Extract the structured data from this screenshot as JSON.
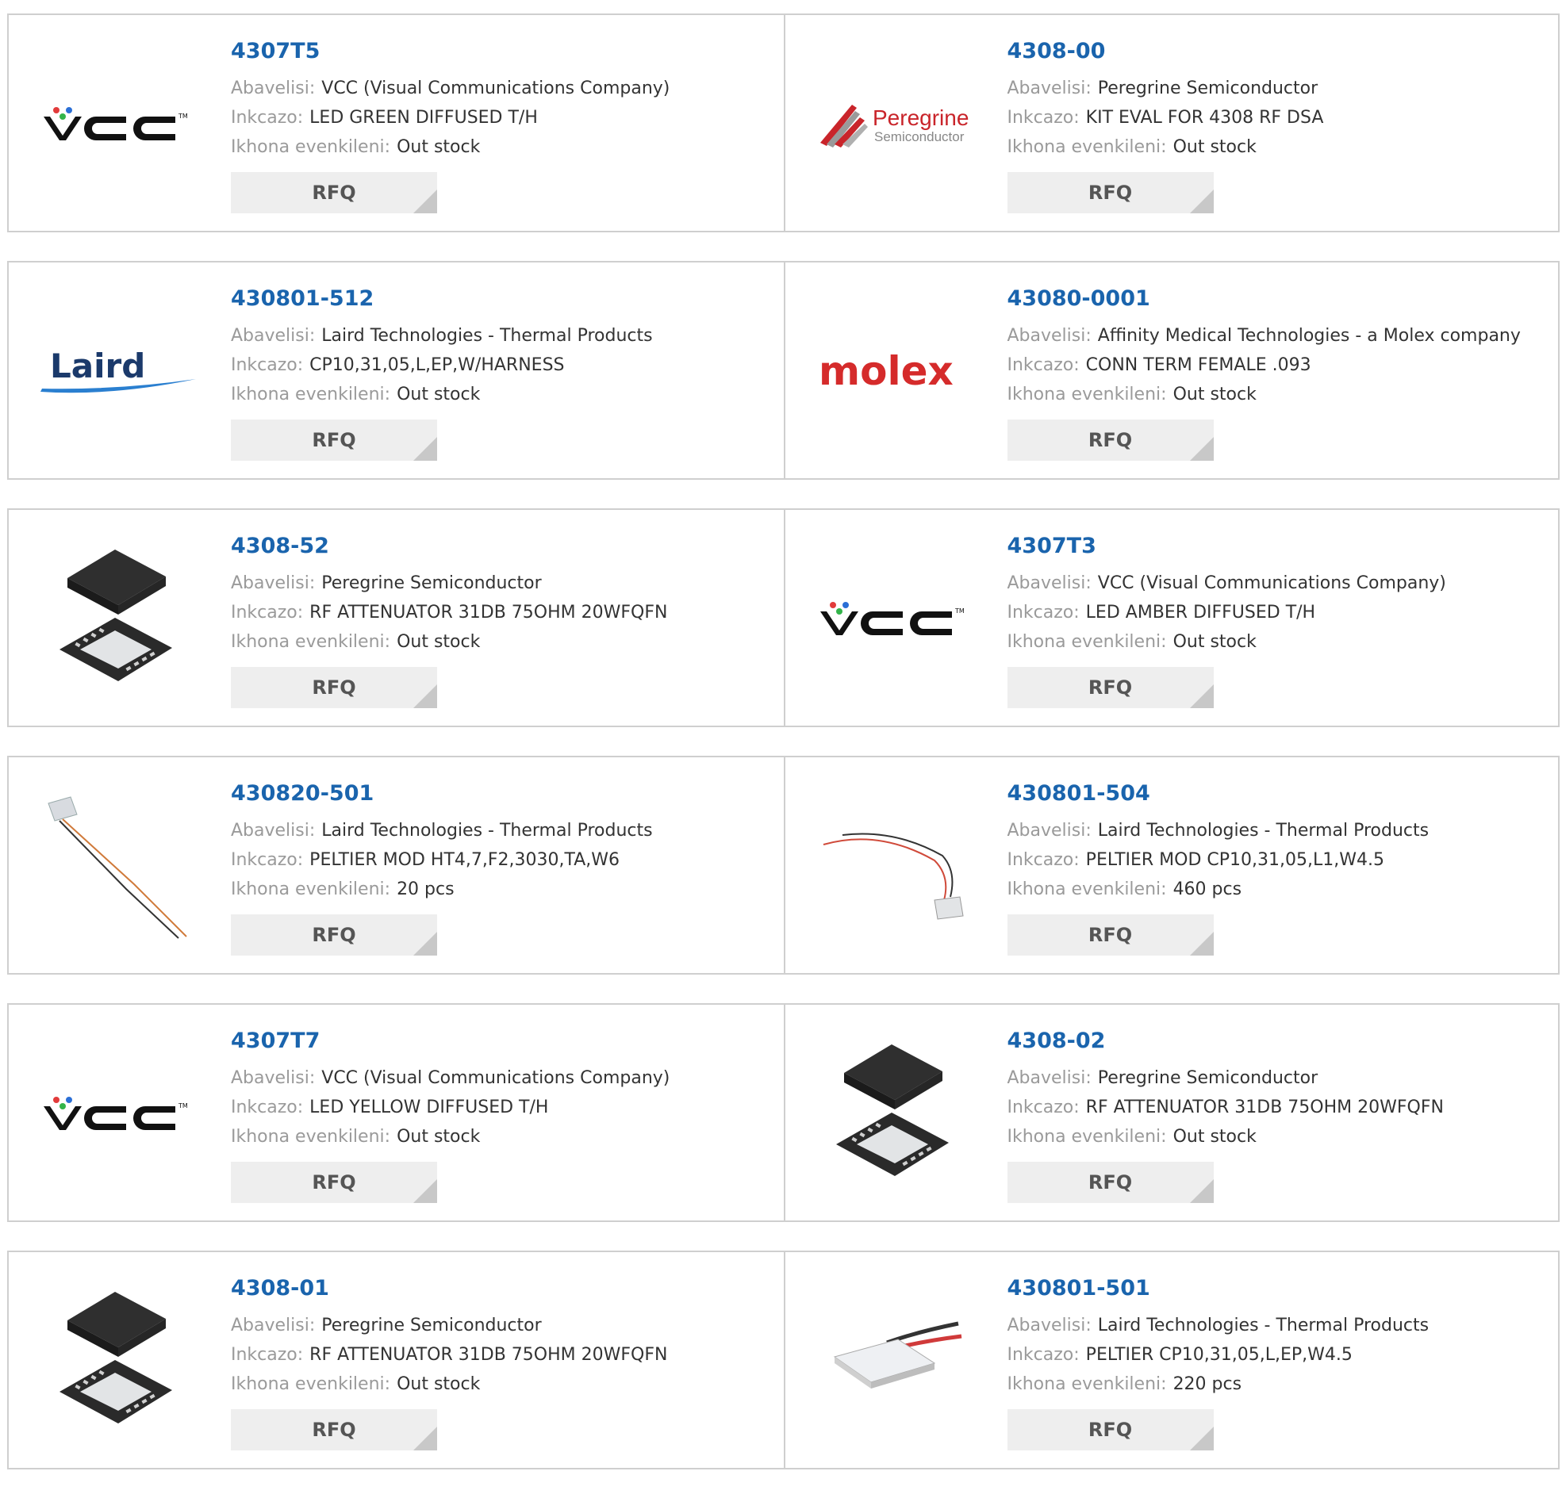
{
  "labels": {
    "supplier": "Abavelisi:",
    "description": "Inkcazo:",
    "stock": "Ikhona evenkileni:",
    "rfq": "RFQ"
  },
  "colors": {
    "part_link": "#1a64ad",
    "label": "#9a9a9a",
    "value": "#333333",
    "border": "#cfcfcf",
    "button_bg": "#eeeeee"
  },
  "products": [
    {
      "part": "4307T5",
      "supplier": "VCC (Visual Communications Company)",
      "description": "LED GREEN DIFFUSED T/H",
      "stock": "Out stock",
      "image": "vcc-logo"
    },
    {
      "part": "4308-00",
      "supplier": "Peregrine Semiconductor",
      "description": "KIT EVAL FOR 4308 RF DSA",
      "stock": "Out stock",
      "image": "peregrine-logo"
    },
    {
      "part": "430801-512",
      "supplier": "Laird Technologies - Thermal Products",
      "description": "CP10,31,05,L,EP,W/HARNESS",
      "stock": "Out stock",
      "image": "laird-logo"
    },
    {
      "part": "43080-0001",
      "supplier": "Affinity Medical Technologies - a Molex company",
      "description": "CONN TERM FEMALE .093",
      "stock": "Out stock",
      "image": "molex-logo"
    },
    {
      "part": "4308-52",
      "supplier": "Peregrine Semiconductor",
      "description": "RF ATTENUATOR 31DB 75OHM 20WFQFN",
      "stock": "Out stock",
      "image": "qfn-chip-photo"
    },
    {
      "part": "4307T3",
      "supplier": "VCC (Visual Communications Company)",
      "description": "LED AMBER DIFFUSED T/H",
      "stock": "Out stock",
      "image": "vcc-logo"
    },
    {
      "part": "430820-501",
      "supplier": "Laird Technologies - Thermal Products",
      "description": "PELTIER MOD HT4,7,F2,3030,TA,W6",
      "stock": "20 pcs",
      "image": "peltier-long-leads-photo"
    },
    {
      "part": "430801-504",
      "supplier": "Laird Technologies - Thermal Products",
      "description": "PELTIER MOD CP10,31,05,L1,W4.5",
      "stock": "460 pcs",
      "image": "peltier-curved-leads-photo"
    },
    {
      "part": "4307T7",
      "supplier": "VCC (Visual Communications Company)",
      "description": "LED YELLOW DIFFUSED T/H",
      "stock": "Out stock",
      "image": "vcc-logo"
    },
    {
      "part": "4308-02",
      "supplier": "Peregrine Semiconductor",
      "description": "RF ATTENUATOR 31DB 75OHM 20WFQFN",
      "stock": "Out stock",
      "image": "qfn-chip-photo"
    },
    {
      "part": "4308-01",
      "supplier": "Peregrine Semiconductor",
      "description": "RF ATTENUATOR 31DB 75OHM 20WFQFN",
      "stock": "Out stock",
      "image": "qfn-chip-photo"
    },
    {
      "part": "430801-501",
      "supplier": "Laird Technologies - Thermal Products",
      "description": "PELTIER CP10,31,05,L,EP,W4.5",
      "stock": "220 pcs",
      "image": "peltier-module-photo"
    }
  ]
}
